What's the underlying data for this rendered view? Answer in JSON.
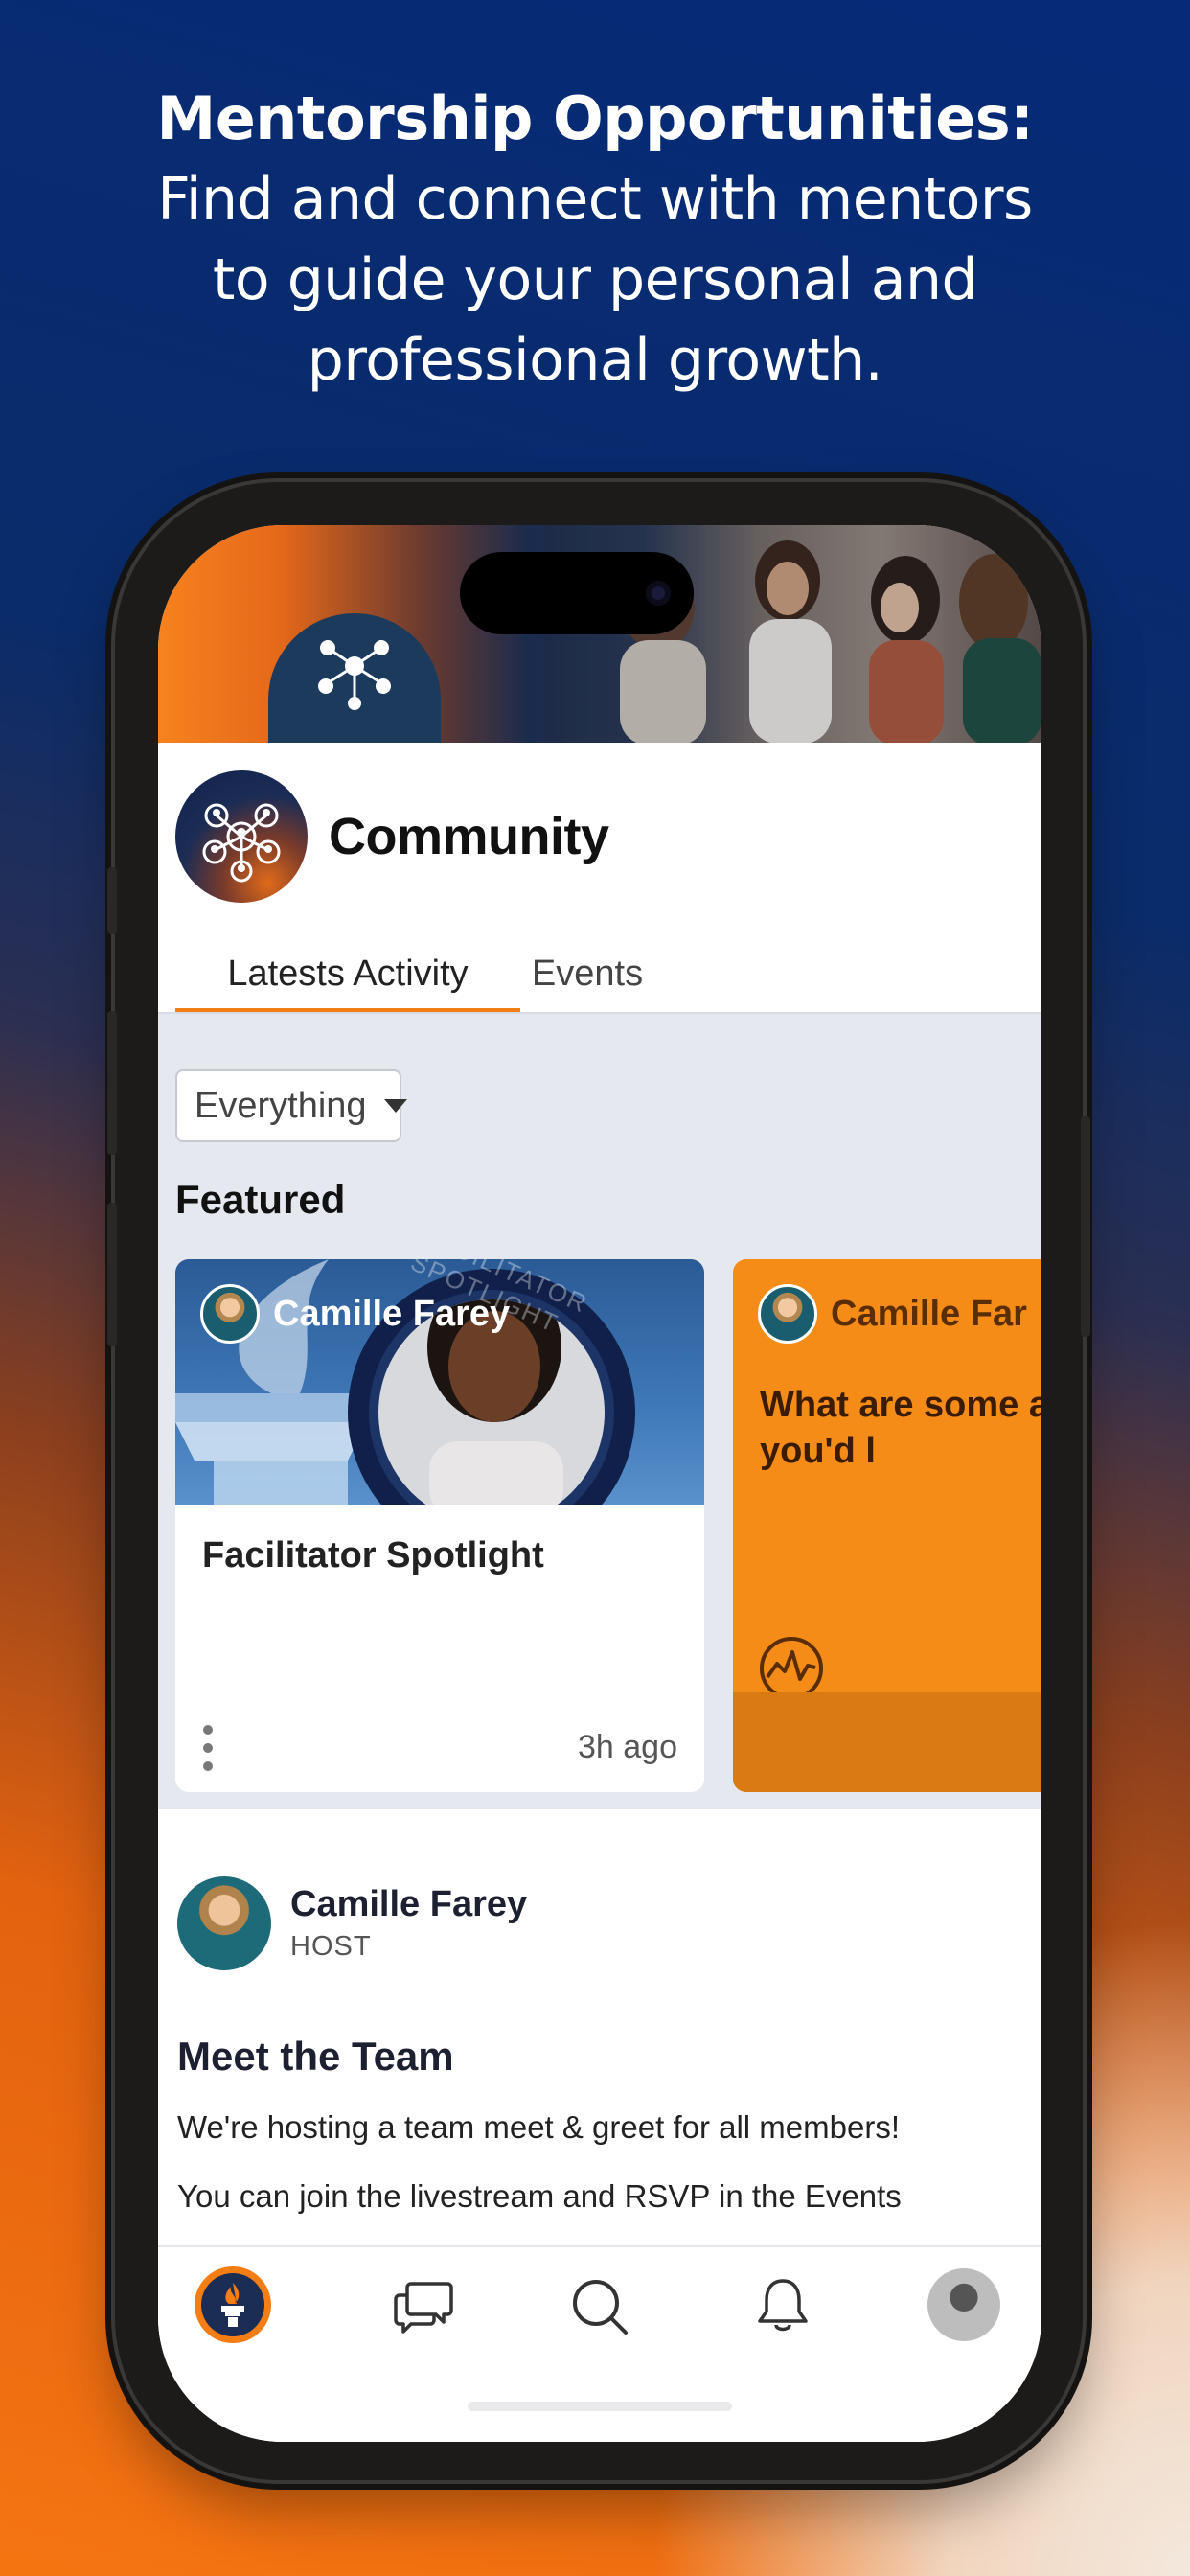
{
  "headline": {
    "title": "Mentorship Opportunities:",
    "subtitle": "Find and connect with mentors to guide your personal and professional growth."
  },
  "community": {
    "title": "Community",
    "avatar_icon": "network-icon"
  },
  "tabs": [
    {
      "label": "Latests Activity",
      "active": true
    },
    {
      "label": "Events",
      "active": false
    }
  ],
  "filter": {
    "selected": "Everything"
  },
  "featured": {
    "heading": "Featured",
    "cards": [
      {
        "author": "Camille Farey",
        "image_text": "FACILITATOR SPOTLIGHT",
        "title": "Facilitator Spotlight",
        "time": "3h ago"
      },
      {
        "author": "Camille Far",
        "question": "What are some activites you'd l",
        "icon": "chart-circle-icon"
      }
    ]
  },
  "post": {
    "author": "Camille Farey",
    "role": "HOST",
    "title": "Meet the Team",
    "paragraphs": [
      "We're hosting a team meet & greet for all members!",
      "You can join the livestream and RSVP in the Events"
    ]
  },
  "nav": {
    "items": [
      "home-torch-icon",
      "chat-bubbles-icon",
      "search-icon",
      "bell-icon",
      "profile-avatar"
    ]
  },
  "colors": {
    "accent": "#f47d14",
    "navy": "#1b2d55",
    "card_orange": "#f58c17"
  }
}
